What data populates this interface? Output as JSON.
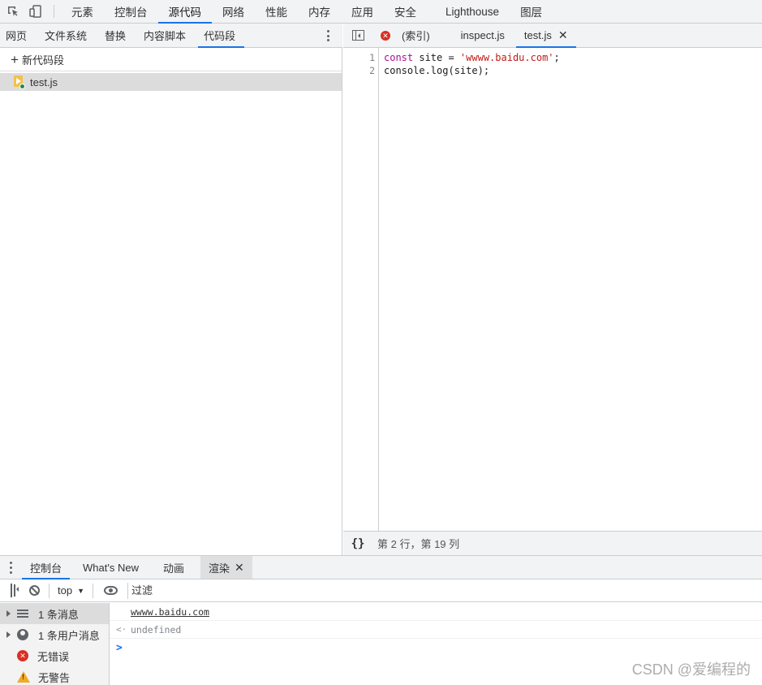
{
  "topbar": {
    "tabs": [
      "元素",
      "控制台",
      "源代码",
      "网络",
      "性能",
      "内存",
      "应用",
      "安全",
      "Lighthouse",
      "图层"
    ]
  },
  "navigator": {
    "tabs": [
      "网页",
      "文件系统",
      "替换",
      "内容脚本",
      "代码段"
    ],
    "new_snippet": "新代码段",
    "files": [
      "test.js"
    ]
  },
  "editor": {
    "tabs": [
      "(索引)",
      "inspect.js",
      "test.js"
    ],
    "line_numbers": [
      "1",
      "2"
    ],
    "code": {
      "line1_kw": "const",
      "line1_mid": " site = ",
      "line1_str": "'wwww.baidu.com'",
      "line1_end": ";",
      "line2": "console.log(site);"
    },
    "status": "第 2 行，第 19 列",
    "braces": "{}"
  },
  "drawer": {
    "tabs": [
      "控制台",
      "What's New",
      "动画",
      "渲染"
    ]
  },
  "console": {
    "context": "top",
    "filter_placeholder": "过滤",
    "sidebar": [
      "1 条消息",
      "1 条用户消息",
      "无错误",
      "无警告"
    ],
    "output": {
      "log_value": "wwww.baidu.com",
      "return_marker": "<·",
      "return_value": "undefined",
      "prompt": ">"
    }
  },
  "watermark": "CSDN @爱编程的"
}
